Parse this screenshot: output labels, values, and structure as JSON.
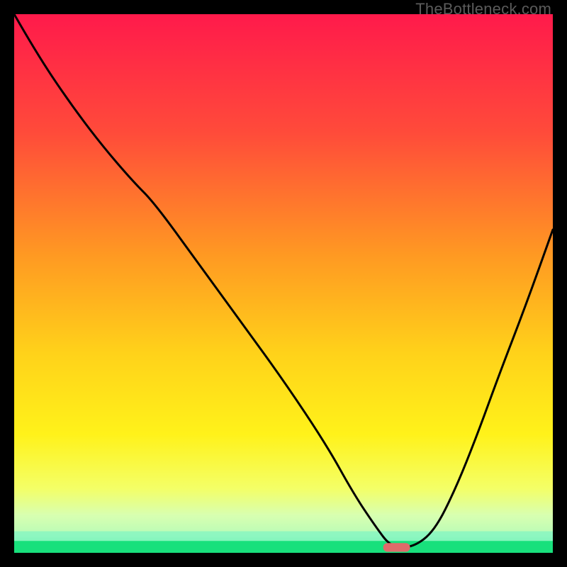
{
  "watermark": "TheBottleneck.com",
  "chart_data": {
    "type": "line",
    "title": "",
    "xlabel": "",
    "ylabel": "",
    "xlim": [
      0,
      100
    ],
    "ylim": [
      0,
      100
    ],
    "grid": false,
    "legend": false,
    "background_gradient_stops": [
      {
        "offset": 0.0,
        "color": "#ff1a4b"
      },
      {
        "offset": 0.22,
        "color": "#ff4b3a"
      },
      {
        "offset": 0.45,
        "color": "#ff9a22"
      },
      {
        "offset": 0.63,
        "color": "#ffd21a"
      },
      {
        "offset": 0.78,
        "color": "#fff21a"
      },
      {
        "offset": 0.88,
        "color": "#f4ff66"
      },
      {
        "offset": 0.93,
        "color": "#d8ffb0"
      },
      {
        "offset": 0.97,
        "color": "#8cf7c0"
      },
      {
        "offset": 1.0,
        "color": "#18e07c"
      }
    ],
    "series": [
      {
        "name": "bottleneck-curve",
        "x": [
          0,
          4,
          10,
          16,
          22,
          26,
          34,
          42,
          50,
          58,
          63,
          67,
          70,
          74,
          78,
          82,
          86,
          90,
          95,
          100
        ],
        "values": [
          100,
          93,
          84,
          76,
          69,
          65,
          54,
          43,
          32,
          20,
          11,
          5,
          1,
          1,
          4,
          12,
          22,
          33,
          46,
          60
        ]
      }
    ],
    "marker": {
      "name": "optimal-point",
      "x": 71,
      "y": 1,
      "width": 5,
      "height": 1.6,
      "color": "#e06a6a"
    },
    "stripe_bands": [
      {
        "y": 4.0,
        "h": 2.8,
        "color": "#d8ffb0",
        "alpha": 0.55
      },
      {
        "y": 2.2,
        "h": 1.8,
        "color": "#8cf7c0",
        "alpha": 0.7
      },
      {
        "y": 0.0,
        "h": 2.2,
        "color": "#18e07c",
        "alpha": 1.0
      }
    ]
  }
}
